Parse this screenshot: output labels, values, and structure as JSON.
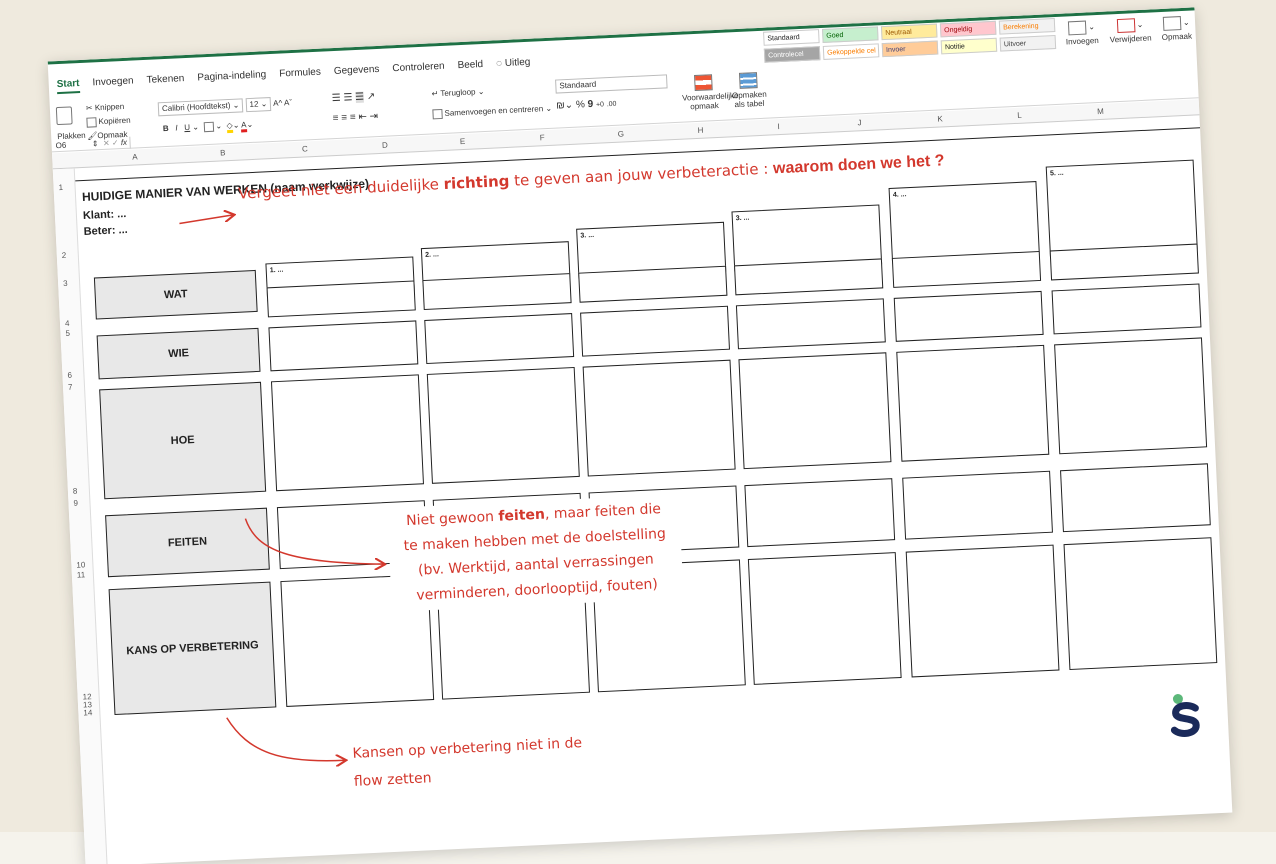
{
  "ribbon": {
    "tabs": [
      "Start",
      "Invoegen",
      "Tekenen",
      "Pagina-indeling",
      "Formules",
      "Gegevens",
      "Controleren",
      "Beeld",
      "Uitleg"
    ],
    "clipboard": {
      "paste": "Plakken",
      "cut": "Knippen",
      "copy": "Kopiëren",
      "format": "Opmaak"
    },
    "font": {
      "name": "Calibri (Hoofdtekst)",
      "size": "12",
      "bold": "B",
      "italic": "I",
      "underline": "U"
    },
    "wrap": "Terugloop",
    "merge": "Samenvoegen en centreren",
    "number_format": "Standaard",
    "percent": "%",
    "comma": "9",
    "cond_format": "Voorwaardelijke opmaak",
    "format_table": "Opmaken als tabel",
    "styles": [
      {
        "label": "Standaard",
        "color": "#ffffff",
        "text": "#222222"
      },
      {
        "label": "Goed",
        "color": "#c6efce",
        "text": "#006100"
      },
      {
        "label": "Neutraal",
        "color": "#ffeb9c",
        "text": "#9c5700"
      },
      {
        "label": "Ongeldig",
        "color": "#ffc7ce",
        "text": "#9c0006"
      },
      {
        "label": "Berekening",
        "color": "#f2f2f2",
        "text": "#fa7d00"
      },
      {
        "label": "Controlecel",
        "color": "#a5a5a5",
        "text": "#ffffff"
      },
      {
        "label": "Gekoppelde cel",
        "color": "#ffffff",
        "text": "#fa7d00"
      },
      {
        "label": "Invoer",
        "color": "#ffcc99",
        "text": "#3f3f76"
      },
      {
        "label": "Notitie",
        "color": "#ffffcc",
        "text": "#222222"
      },
      {
        "label": "Uitvoer",
        "color": "#f2f2f2",
        "text": "#3f3f3f"
      }
    ],
    "insert": "Invoegen",
    "delete": "Verwijderen",
    "cell_format": "Opmaak"
  },
  "formula_bar": {
    "cell_ref": "O6",
    "fx": "fx"
  },
  "columns": [
    "A",
    "B",
    "C",
    "D",
    "E",
    "F",
    "G",
    "H",
    "I",
    "J",
    "K",
    "L",
    "M"
  ],
  "rows": [
    "1",
    "2",
    "3",
    "4",
    "5",
    "6",
    "7",
    "8",
    "9",
    "10",
    "11",
    "12",
    "13",
    "14"
  ],
  "sheet": {
    "title": "HUIDIGE MANIER VAN WERKEN (naam werkwijze)",
    "klant": "Klant: ...",
    "beter": "Beter: ...",
    "row_labels": [
      "WAT",
      "WIE",
      "HOE",
      "FEITEN",
      "KANS OP VERBETERING"
    ],
    "step_labels": [
      "1. ...",
      "2. ...",
      "3. ...",
      "3. ...",
      "4. ...",
      "5. ..."
    ]
  },
  "annotations": {
    "top_a": "Vergeet niet een duidelijke ",
    "top_b": "richting",
    "top_c": " te geven aan jouw verbeteractie : ",
    "top_d": "waarom doen we het ?",
    "feiten_line1a": "Niet gewoon ",
    "feiten_line1b": "feiten",
    "feiten_line1c": ", maar feiten die",
    "feiten_line2": "te maken hebben met de doelstelling",
    "feiten_line3": "(bv. Werktijd, aantal verrassingen",
    "feiten_line4": "verminderen, doorlooptijd, fouten)",
    "kans_line1": "Kansen op verbetering niet in de",
    "kans_line2": "flow zetten"
  },
  "colors": {
    "accent": "#1e7145",
    "annotation": "#d3382d",
    "header_fill": "#e8e8e8",
    "background": "#efeade"
  }
}
